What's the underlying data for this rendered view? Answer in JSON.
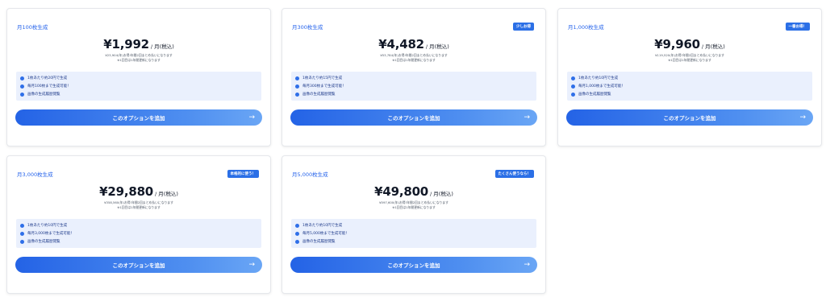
{
  "plans": [
    {
      "name": "月100枚生成",
      "badge": "",
      "price": "¥1,992",
      "unit": "/ 月(税込)",
      "note1": "¥23,904(年)お得!年間2回まとめ払いになります",
      "note2": "※1回目は1年間更新になります",
      "features": [
        "1枚あたり約20円で生成",
        "毎月100枚まで生成可能！",
        "画像の生成履歴閲覧"
      ],
      "button": "このオプションを追加"
    },
    {
      "name": "月300枚生成",
      "badge": "少しお得",
      "price": "¥4,482",
      "unit": "/ 月(税込)",
      "note1": "¥53,784(年)お得!年間2回まとめ払いになります",
      "note2": "※1回目は1年間更新になります",
      "features": [
        "1枚あたり約15円で生成",
        "毎月300枚まで生成可能！",
        "画像の生成履歴閲覧"
      ],
      "button": "このオプションを追加"
    },
    {
      "name": "月1,000枚生成",
      "badge": "一番お得！",
      "price": "¥9,960",
      "unit": "/ 月(税込)",
      "note1": "¥119,520(年)お得!年間2回まとめ払いになります",
      "note2": "※1回目は1年間更新になります",
      "features": [
        "1枚あたり約10円で生成",
        "毎月1,000枚まで生成可能！",
        "画像の生成履歴閲覧"
      ],
      "button": "このオプションを追加"
    },
    {
      "name": "月3,000枚生成",
      "badge": "本格的に使う！",
      "price": "¥29,880",
      "unit": "/ 月(税込)",
      "note1": "¥358,560(年)お得!年間2回まとめ払いになります",
      "note2": "※1回目は1年間更新になります",
      "features": [
        "1枚あたり約10円で生成",
        "毎月3,000枚まで生成可能！",
        "画像の生成履歴閲覧"
      ],
      "button": "このオプションを追加"
    },
    {
      "name": "月5,000枚生成",
      "badge": "たくさん使うなら！",
      "price": "¥49,800",
      "unit": "/ 月(税込)",
      "note1": "¥597,600(年)お得!年間2回まとめ払いになります",
      "note2": "※1回目は1年間更新になります",
      "features": [
        "1枚あたり約10円で生成",
        "毎月5,000枚まで生成可能！",
        "画像の生成履歴閲覧"
      ],
      "button": "このオプションを追加"
    }
  ],
  "icons": {
    "feature": "check-circle-icon",
    "button": "arrow-right-icon"
  },
  "colors": {
    "accent": "#2563eb",
    "feature_bg": "#eaf0fd",
    "badge": "#2b6fe6"
  }
}
